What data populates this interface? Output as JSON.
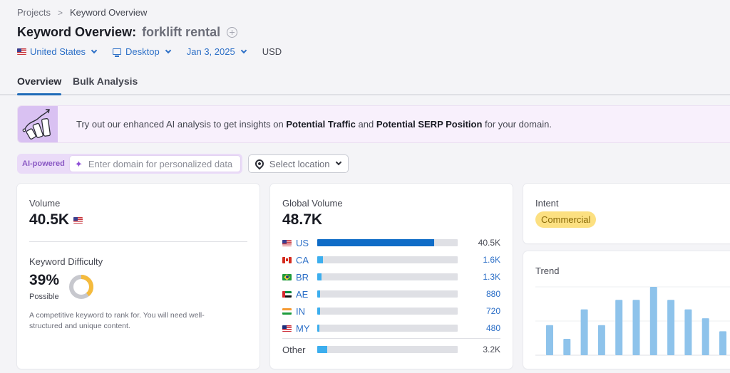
{
  "breadcrumb": {
    "items": [
      {
        "label": "Projects"
      },
      {
        "label": "Keyword Overview"
      }
    ],
    "separator": ">"
  },
  "header": {
    "title_prefix": "Keyword Overview:",
    "keyword": "forklift rental"
  },
  "filters": {
    "country": {
      "label": "United States",
      "flag": "us"
    },
    "device": {
      "label": "Desktop",
      "icon": "monitor-icon"
    },
    "date": {
      "label": "Jan 3, 2025"
    },
    "currency": "USD"
  },
  "tabs": [
    {
      "label": "Overview",
      "active": true
    },
    {
      "label": "Bulk Analysis",
      "active": false
    }
  ],
  "banner": {
    "text_before": "Try out our enhanced AI analysis to get insights on ",
    "highlight1": "Potential Traffic",
    "text_middle": " and ",
    "highlight2": "Potential SERP Position",
    "text_after": " for your domain."
  },
  "ai_search": {
    "badge": "AI-powered",
    "domain_placeholder": "Enter domain for personalized data",
    "domain_value": "",
    "location_placeholder": "Select location"
  },
  "volume_card": {
    "label": "Volume",
    "value": "40.5K",
    "flag": "us",
    "kd_label": "Keyword Difficulty",
    "kd_value": "39%",
    "kd_percent": 39,
    "kd_level": "Possible",
    "kd_description": "A competitive keyword to rank for. You will need well-structured and unique content.",
    "kd_color": "#f5bb3d"
  },
  "global_volume_card": {
    "label": "Global Volume",
    "value": "48.7K",
    "countries": [
      {
        "code": "US",
        "flag": "us",
        "value": "40.5K",
        "share": 0.83
      },
      {
        "code": "CA",
        "flag": "ca",
        "value": "1.6K",
        "share": 0.04
      },
      {
        "code": "BR",
        "flag": "br",
        "value": "1.3K",
        "share": 0.03
      },
      {
        "code": "AE",
        "flag": "ae",
        "value": "880",
        "share": 0.02
      },
      {
        "code": "IN",
        "flag": "in",
        "value": "720",
        "share": 0.02
      },
      {
        "code": "MY",
        "flag": "my",
        "value": "480",
        "share": 0.01
      }
    ],
    "other": {
      "label": "Other",
      "value": "3.2K",
      "share": 0.07
    }
  },
  "intent_card": {
    "label": "Intent",
    "badge": "Commercial"
  },
  "trend_card": {
    "label": "Trend",
    "chart_data": {
      "type": "bar",
      "title": "Trend",
      "values": [
        0.44,
        0.24,
        0.67,
        0.44,
        0.81,
        0.81,
        1.0,
        0.81,
        0.67,
        0.54,
        0.35
      ],
      "ylim": [
        0,
        1
      ],
      "grid": true,
      "bar_color": "#8ec3eb"
    }
  }
}
